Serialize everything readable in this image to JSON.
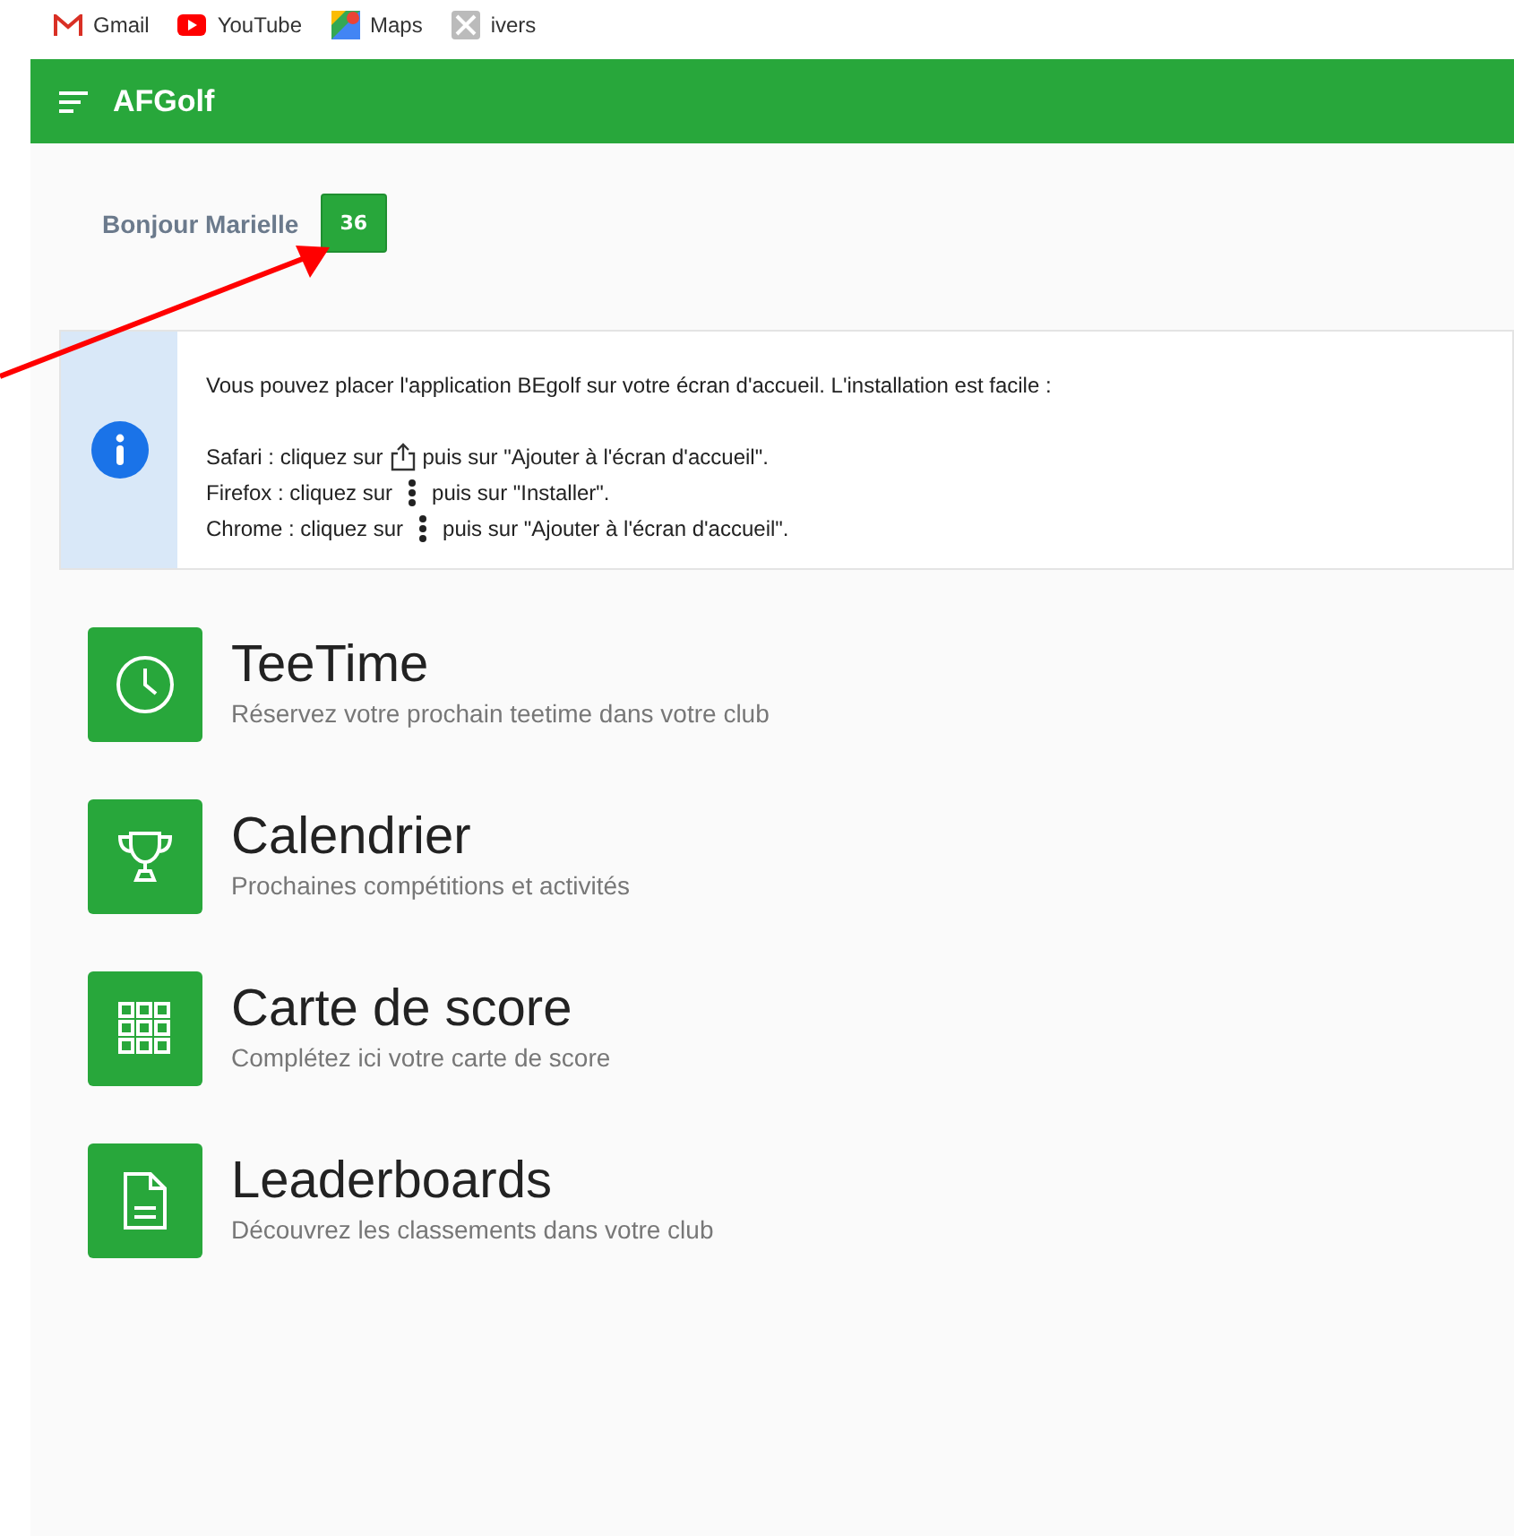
{
  "bookmarks": [
    {
      "kind": "gmail",
      "label": "Gmail"
    },
    {
      "kind": "youtube",
      "label": "YouTube"
    },
    {
      "kind": "maps",
      "label": "Maps"
    },
    {
      "kind": "generic",
      "label": "ivers"
    }
  ],
  "app_bar": {
    "title": "AFGolf"
  },
  "greeting": {
    "text": "Bonjour Marielle",
    "badge": "36"
  },
  "info": {
    "intro": "Vous pouvez placer l'application BEgolf sur votre écran d'accueil. L'installation est facile :",
    "lines": [
      {
        "kind": "share",
        "before": "Safari : cliquez sur",
        "after": "puis sur \"Ajouter à l'écran d'accueil\"."
      },
      {
        "kind": "dots",
        "before": "Firefox : cliquez sur",
        "after": "puis sur \"Installer\"."
      },
      {
        "kind": "dots",
        "before": "Chrome : cliquez sur",
        "after": "puis sur \"Ajouter à l'écran d'accueil\"."
      }
    ]
  },
  "menu": [
    {
      "kind": "clock",
      "title": "TeeTime",
      "subtitle": "Réservez votre prochain teetime dans votre club"
    },
    {
      "kind": "trophy",
      "title": "Calendrier",
      "subtitle": "Prochaines compétitions et activités"
    },
    {
      "kind": "grid",
      "title": "Carte de score",
      "subtitle": "Complétez ici votre carte de score"
    },
    {
      "kind": "document",
      "title": "Leaderboards",
      "subtitle": "Découvrez les classements dans votre club"
    }
  ]
}
